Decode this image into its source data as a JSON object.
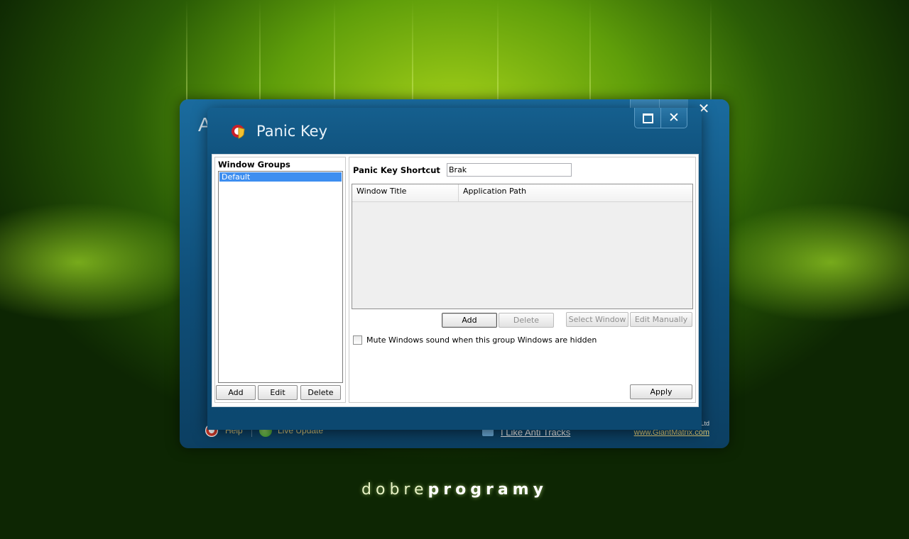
{
  "background": {
    "brand_part1": "dobre",
    "brand_part2": "programy"
  },
  "back_window": {
    "title_letter": "A",
    "controls": [
      "..",
      "",
      "✕"
    ],
    "footer": {
      "help": "Help",
      "live_update": "Live Update",
      "like": "I Like Anti Tracks",
      "ltd": "Ltd",
      "url": "www.GiantMatrix.com"
    }
  },
  "dialog": {
    "title": "Panic Key",
    "icon": "panic-shield-icon",
    "close_glyph": "✕",
    "left_pane": {
      "title": "Window Groups",
      "groups": [
        "Default"
      ],
      "buttons": {
        "add": "Add",
        "edit": "Edit",
        "delete": "Delete"
      }
    },
    "right_pane": {
      "shortcut_label": "Panic Key Shortcut",
      "shortcut_value": "Brak",
      "table": {
        "columns": [
          "Window Title",
          "Application Path"
        ],
        "rows": []
      },
      "buttons": {
        "add": "Add",
        "delete": "Delete",
        "select_window": "Select Window",
        "edit_manually": "Edit Manually",
        "apply": "Apply"
      },
      "mute_label": "Mute Windows sound when this group Windows are hidden",
      "mute_checked": false
    }
  },
  "colors": {
    "title_bar": "#155f8e",
    "selection": "#3d8ef0",
    "background_green": "#5f9e0a"
  }
}
